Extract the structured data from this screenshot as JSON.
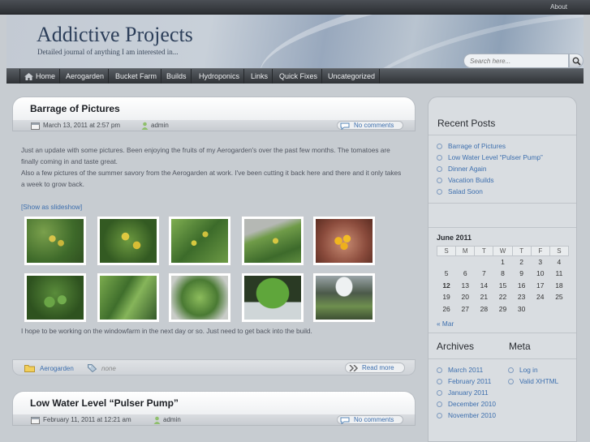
{
  "topbar": {
    "about": "About"
  },
  "header": {
    "title": "Addictive Projects",
    "description": "Detailed journal of anything I am interested in..."
  },
  "search": {
    "placeholder": "Search here..."
  },
  "nav": {
    "items": [
      "Home",
      "Aerogarden",
      "Bucket Farm",
      "Builds",
      "Hydroponics",
      "Links",
      "Quick Fixes",
      "Uncategorized"
    ]
  },
  "posts": [
    {
      "title": "Barrage of Pictures",
      "date": "March 13, 2011 at 2:57 pm",
      "author": "admin",
      "comments": "No comments",
      "body": [
        "Just an update with some pictures. Been enjoying the fruits of my Aerogarden's over the past few months. The tomatoes are finally coming in and taste great.",
        "Also a few pictures of the summer savory from the Aerogarden at work. I've been cutting it back here and there and it only takes a week to grow back."
      ],
      "slideshow": "[Show as slideshow]",
      "after": "I hope to be working on the windowfarm in the next day or so. Just need to get back into the build.",
      "category": "Aerogarden",
      "tags": "none",
      "read_more": "Read more"
    },
    {
      "title": "Low Water Level “Pulser Pump”",
      "date": "February 11, 2011 at 12:21 am",
      "author": "admin",
      "comments": "No comments"
    }
  ],
  "sidebar": {
    "recent_title": "Recent Posts",
    "recent": [
      "Barrage of Pictures",
      "Low Water Level “Pulser Pump”",
      "Dinner Again",
      "Vacation Builds",
      "Salad Soon"
    ],
    "calendar": {
      "title": "June 2011",
      "days": [
        "S",
        "M",
        "T",
        "W",
        "T",
        "F",
        "S"
      ],
      "weeks": [
        [
          "",
          "",
          "",
          "1",
          "2",
          "3",
          "4"
        ],
        [
          "5",
          "6",
          "7",
          "8",
          "9",
          "10",
          "11"
        ],
        [
          "12",
          "13",
          "14",
          "15",
          "16",
          "17",
          "18"
        ],
        [
          "19",
          "20",
          "21",
          "22",
          "23",
          "24",
          "25"
        ],
        [
          "26",
          "27",
          "28",
          "29",
          "30",
          "",
          ""
        ]
      ],
      "today": "12",
      "prev": "« Mar"
    },
    "archives_title": "Archives",
    "archives": [
      "March 2011",
      "February 2011",
      "January 2011",
      "December 2010",
      "November 2010"
    ],
    "meta_title": "Meta",
    "meta": [
      "Log in",
      "Valid XHTML"
    ]
  }
}
